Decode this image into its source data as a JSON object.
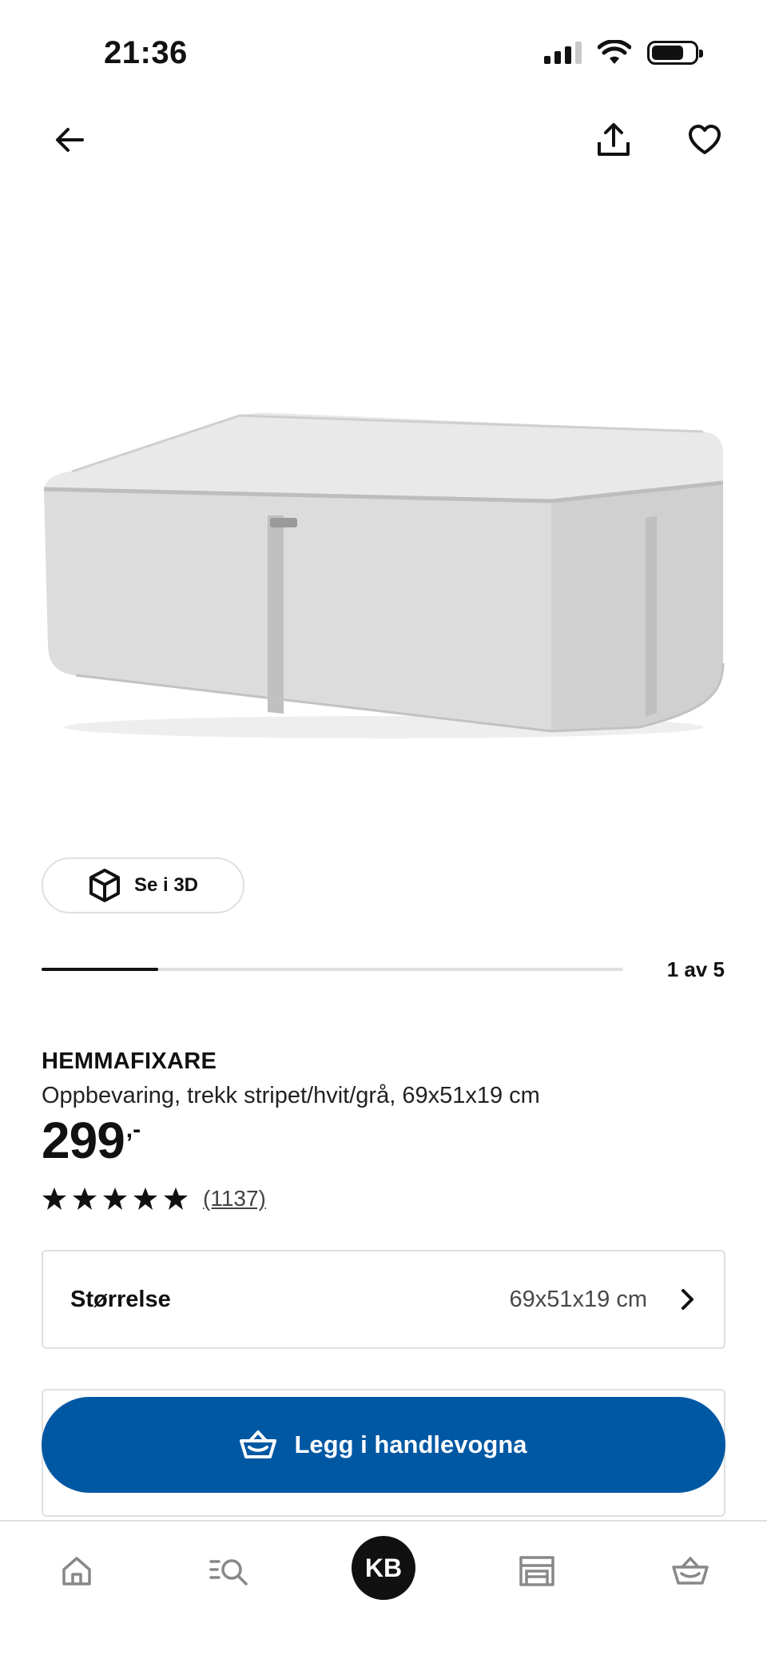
{
  "status_bar": {
    "time": "21:36"
  },
  "product": {
    "name": "HEMMAFIXARE",
    "description": "Oppbevaring, trekk stripet/hvit/grå, 69x51x19 cm",
    "price_integer": "299",
    "price_suffix": ",-",
    "rating": 5,
    "rating_count": "(1137)"
  },
  "gallery": {
    "view_3d_label": "Se i 3D",
    "counter": "1 av 5",
    "current_index": 1,
    "total_images": 5
  },
  "size_selector": {
    "label": "Størrelse",
    "value": "69x51x19 cm"
  },
  "cart_button": {
    "label": "Legg i handlevogna"
  },
  "bottom_nav": {
    "profile_initials": "KB",
    "tabs": [
      "home-icon",
      "search-icon",
      "profile-avatar",
      "store-icon",
      "basket-icon"
    ]
  },
  "colors": {
    "accent": "#0058a3",
    "text": "#111111",
    "border": "#dfdfdf"
  }
}
